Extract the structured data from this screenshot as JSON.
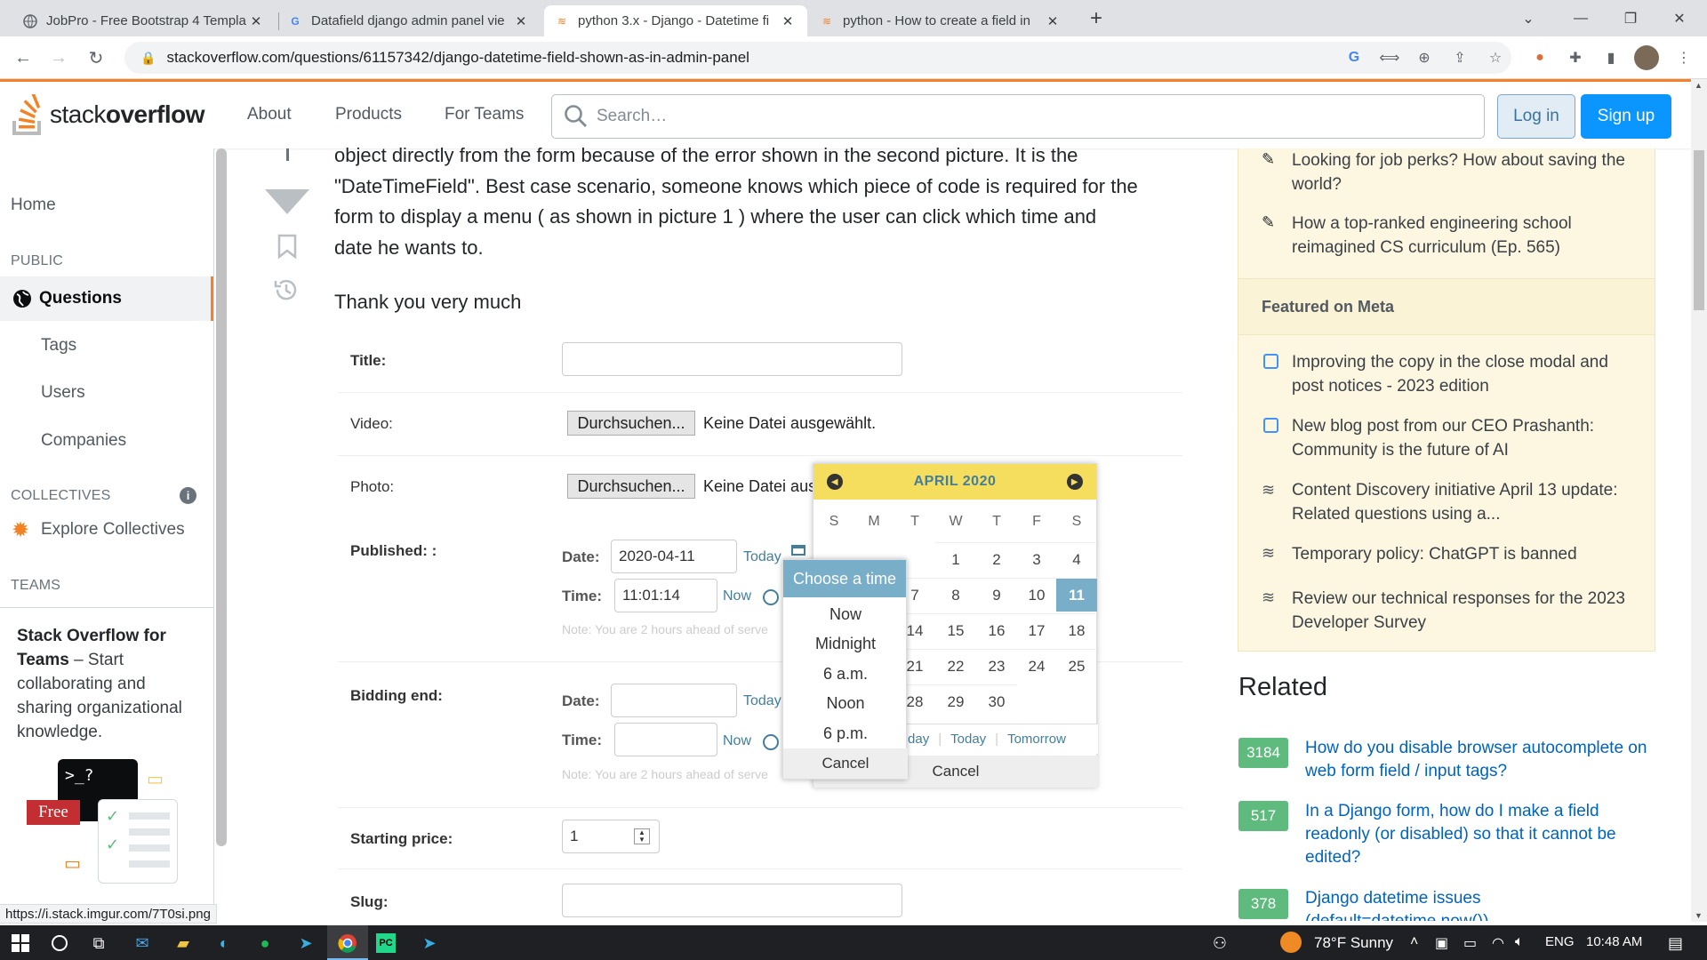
{
  "browser": {
    "tabs": [
      {
        "title": "JobPro - Free Bootstrap 4 Templa",
        "active": false
      },
      {
        "title": "Datafield django admin panel vie",
        "active": false
      },
      {
        "title": "python 3.x - Django - Datetime fi",
        "active": true
      },
      {
        "title": "python - How to create a field in",
        "active": false
      }
    ],
    "url": "stackoverflow.com/questions/61157342/django-datetime-field-shown-as-in-admin-panel",
    "status_url": "https://i.stack.imgur.com/7T0si.png"
  },
  "header": {
    "logo_text_light": "stack",
    "logo_text_bold": "overflow",
    "nav": [
      "About",
      "Products",
      "For Teams"
    ],
    "search_placeholder": "Search…",
    "login": "Log in",
    "signup": "Sign up"
  },
  "leftnav": {
    "home": "Home",
    "public": "PUBLIC",
    "questions": "Questions",
    "tags": "Tags",
    "users": "Users",
    "companies": "Companies",
    "collectives": "COLLECTIVES",
    "explore": "Explore Collectives",
    "teams": "TEAMS",
    "teams_title": "Stack Overflow for Teams",
    "teams_desc": " – Start collaborating and sharing organizational knowledge.",
    "free": "Free"
  },
  "question": {
    "line1": "object directly from the form because of the error shown in the second picture. It is the",
    "line2": "\"DateTimeField\". Best case scenario, someone knows which piece of code is required for the",
    "line3": "form to display a menu ( as shown in picture 1 ) where the user can click which time and",
    "line4": "date he wants to.",
    "thanks": "Thank you very much"
  },
  "form": {
    "title_label": "Title:",
    "video_label": "Video:",
    "photo_label": "Photo:",
    "browse": "Durchsuchen...",
    "no_file": "Keine Datei ausgewählt.",
    "no_file_cut": "Keine Datei aus",
    "published_label": "Published: :",
    "date_label": "Date:",
    "time_label": "Time:",
    "published_date": "2020-04-11",
    "published_time": "11:01:14",
    "today": "Today",
    "now": "Now",
    "note": "Note: You are 2 hours ahead of serve",
    "bidding_label": "Bidding end:",
    "price_label": "Starting price:",
    "price_value": "1",
    "slug_label": "Slug:"
  },
  "calendar": {
    "caption": "APRIL 2020",
    "dow": [
      "S",
      "M",
      "T",
      "W",
      "T",
      "F",
      "S"
    ],
    "rows": [
      [
        "",
        "",
        "",
        "1",
        "2",
        "3",
        "4"
      ],
      [
        "",
        "",
        "7",
        "8",
        "9",
        "10",
        "11"
      ],
      [
        "",
        "",
        "14",
        "15",
        "16",
        "17",
        "18"
      ],
      [
        "",
        "",
        "21",
        "22",
        "23",
        "24",
        "25"
      ],
      [
        "",
        "",
        "28",
        "29",
        "30",
        "",
        ""
      ]
    ],
    "selected": "11",
    "yesterday_cut": "day",
    "today": "Today",
    "tomorrow": "Tomorrow",
    "cancel": "Cancel"
  },
  "clock": {
    "caption": "Choose a time",
    "options": [
      "Now",
      "Midnight",
      "6 a.m.",
      "Noon",
      "6 p.m."
    ],
    "cancel": "Cancel"
  },
  "sidebar": {
    "blog": [
      "Looking for job perks? How about saving the world?",
      "How a top-ranked engineering school reimagined CS curriculum (Ep. 565)"
    ],
    "meta_title": "Featured on Meta",
    "meta": [
      "Improving the copy in the close modal and post notices - 2023 edition",
      "New blog post from our CEO Prashanth: Community is the future of AI",
      "Content Discovery initiative April 13 update: Related questions using a...",
      "Temporary policy: ChatGPT is banned",
      "Review our technical responses for the 2023 Developer Survey"
    ],
    "related_title": "Related",
    "related": [
      {
        "votes": "3184",
        "title": "How do you disable browser autocomplete on web form field / input tags?"
      },
      {
        "votes": "517",
        "title": "In a Django form, how do I make a field readonly (or disabled) so that it cannot be edited?"
      },
      {
        "votes": "378",
        "title": "Django datetime issues (default=datetime.now())"
      }
    ]
  },
  "taskbar": {
    "weather": "78°F  Sunny",
    "lang": "ENG",
    "time": "10:48 AM"
  },
  "colors": {
    "so_orange": "#f48225",
    "so_blue": "#0a95ff",
    "django_yellow": "#f5dd5d",
    "django_blue": "#79aec8",
    "vote_green": "#5eba7d"
  }
}
